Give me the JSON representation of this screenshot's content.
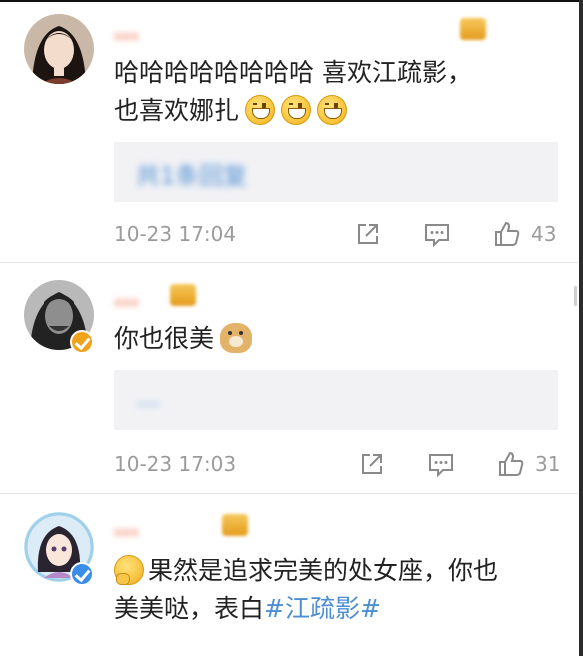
{
  "comments": [
    {
      "username": "…",
      "text": "哈哈哈哈哈哈哈哈 喜欢江疏影，",
      "text2": "也喜欢娜扎",
      "emojis": [
        "grin-emoji",
        "grin-emoji",
        "grin-emoji"
      ],
      "reply_summary": "共1条回复",
      "time": "10-23 17:04",
      "likes": "43",
      "verified": false
    },
    {
      "username": "…",
      "text": "你也很美",
      "emojis": [
        "doge-emoji"
      ],
      "reply_summary": "…",
      "time": "10-23 17:03",
      "likes": "31",
      "verified": true,
      "verified_color": "#f0a31a"
    },
    {
      "username": "…",
      "text_prefix": "果然是追求完美的处女座，你也",
      "text2": "美美哒，表白",
      "topic": "#江疏影#",
      "emojis": [
        "thinking-emoji"
      ],
      "verified": true,
      "verified_color": "#3b8ee8"
    }
  ],
  "icons": {
    "share": "share-icon",
    "comment": "comment-icon",
    "like": "thumbs-up-icon"
  },
  "colors": {
    "username": "#eb7350",
    "topic_link": "#4d8ed3",
    "reply_box_bg": "#f2f2f5",
    "meta_text": "#9b9b9b"
  }
}
